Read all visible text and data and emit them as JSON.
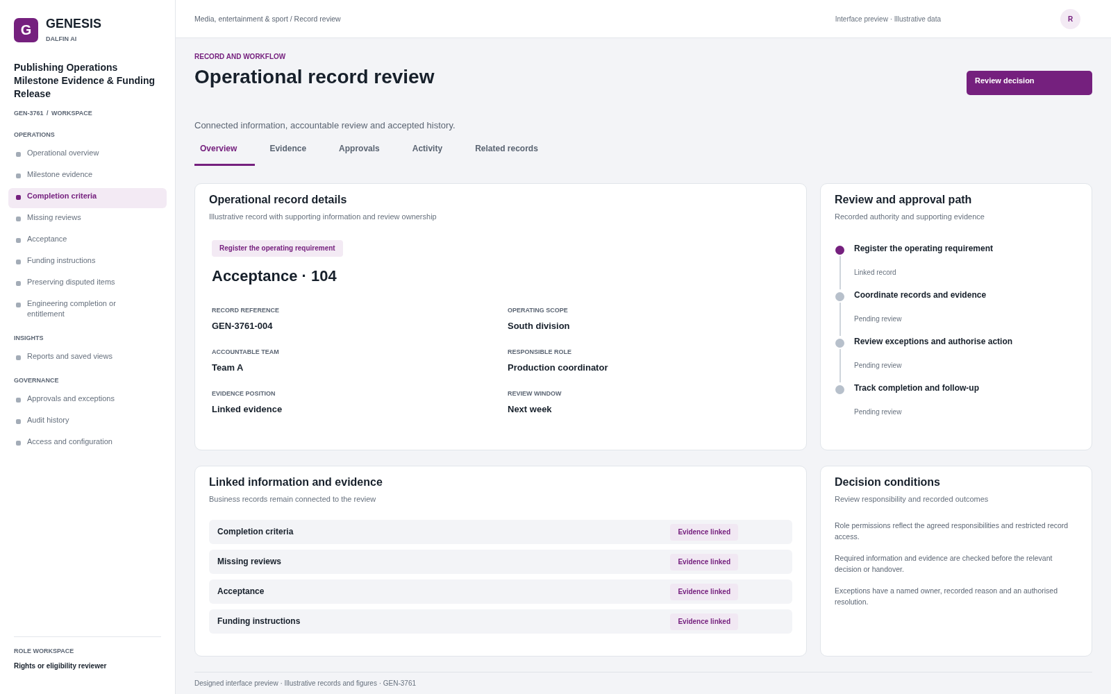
{
  "brand": {
    "logo_letter": "G",
    "name": "GENESIS",
    "subtitle": "DALFIN AI"
  },
  "sidebar": {
    "workspace_title": "Publishing Operations Milestone Evidence & Funding Release",
    "workspace_path": "GEN-3761 / WORKSPACE",
    "sections": [
      {
        "title": "OPERATIONS",
        "items": [
          {
            "label": "Operational overview",
            "selected": false
          },
          {
            "label": "Milestone evidence",
            "selected": false
          },
          {
            "label": "Completion criteria",
            "selected": true
          },
          {
            "label": "Missing reviews",
            "selected": false
          },
          {
            "label": "Acceptance",
            "selected": false
          },
          {
            "label": "Funding instructions",
            "selected": false
          },
          {
            "label": "Preserving disputed items",
            "selected": false
          },
          {
            "label": "Engineering completion or entitlement",
            "selected": false
          }
        ]
      },
      {
        "title": "INSIGHTS",
        "items": [
          {
            "label": "Reports and saved views",
            "selected": false
          }
        ]
      },
      {
        "title": "GOVERNANCE",
        "items": [
          {
            "label": "Approvals and exceptions",
            "selected": false
          },
          {
            "label": "Audit history",
            "selected": false
          },
          {
            "label": "Access and configuration",
            "selected": false
          }
        ]
      }
    ],
    "role": {
      "label": "ROLE WORKSPACE",
      "value": "Rights or eligibility reviewer"
    }
  },
  "top_bar": {
    "breadcrumb": "Media, entertainment & sport / Record review",
    "note": "Interface preview · Illustrative data",
    "avatar": "R"
  },
  "header": {
    "eyebrow": "RECORD AND WORKFLOW",
    "title": "Operational record review",
    "action": "Review decision",
    "description": "Connected information, accountable review and accepted history."
  },
  "tabs": [
    {
      "label": "Overview",
      "selected": true
    },
    {
      "label": "Evidence",
      "selected": false
    },
    {
      "label": "Approvals",
      "selected": false
    },
    {
      "label": "Activity",
      "selected": false
    },
    {
      "label": "Related records",
      "selected": false
    }
  ],
  "record_details": {
    "title": "Operational record details",
    "subtitle": "Illustrative record with supporting information and review ownership",
    "tag": "Register the operating requirement",
    "heading": "Acceptance · 104",
    "fields": [
      {
        "label": "RECORD REFERENCE",
        "value": "GEN-3761-004"
      },
      {
        "label": "OPERATING SCOPE",
        "value": "South division"
      },
      {
        "label": "ACCOUNTABLE TEAM",
        "value": "Team A"
      },
      {
        "label": "RESPONSIBLE ROLE",
        "value": "Production coordinator"
      },
      {
        "label": "EVIDENCE POSITION",
        "value": "Linked evidence"
      },
      {
        "label": "REVIEW WINDOW",
        "value": "Next week"
      }
    ]
  },
  "approval_path": {
    "title": "Review and approval path",
    "subtitle": "Recorded authority and supporting evidence",
    "steps": [
      {
        "title": "Register the operating requirement",
        "status": "Linked record",
        "complete": true
      },
      {
        "title": "Coordinate records and evidence",
        "status": "Pending review",
        "complete": false
      },
      {
        "title": "Review exceptions and authorise action",
        "status": "Pending review",
        "complete": false
      },
      {
        "title": "Track completion and follow-up",
        "status": "Pending review",
        "complete": false
      }
    ]
  },
  "linked_evidence": {
    "title": "Linked information and evidence",
    "subtitle": "Business records remain connected to the review",
    "rows": [
      {
        "name": "Completion criteria",
        "status": "Evidence linked"
      },
      {
        "name": "Missing reviews",
        "status": "Evidence linked"
      },
      {
        "name": "Acceptance",
        "status": "Evidence linked"
      },
      {
        "name": "Funding instructions",
        "status": "Evidence linked"
      }
    ]
  },
  "decision_conditions": {
    "title": "Decision conditions",
    "subtitle": "Review responsibility and recorded outcomes",
    "items": [
      "Role permissions reflect the agreed responsibilities and restricted record access.",
      "Required information and evidence are checked before the relevant decision or handover.",
      "Exceptions have a named owner, recorded reason and an authorised resolution."
    ]
  },
  "footer": "Designed interface preview · Illustrative records and figures · GEN-3761"
}
